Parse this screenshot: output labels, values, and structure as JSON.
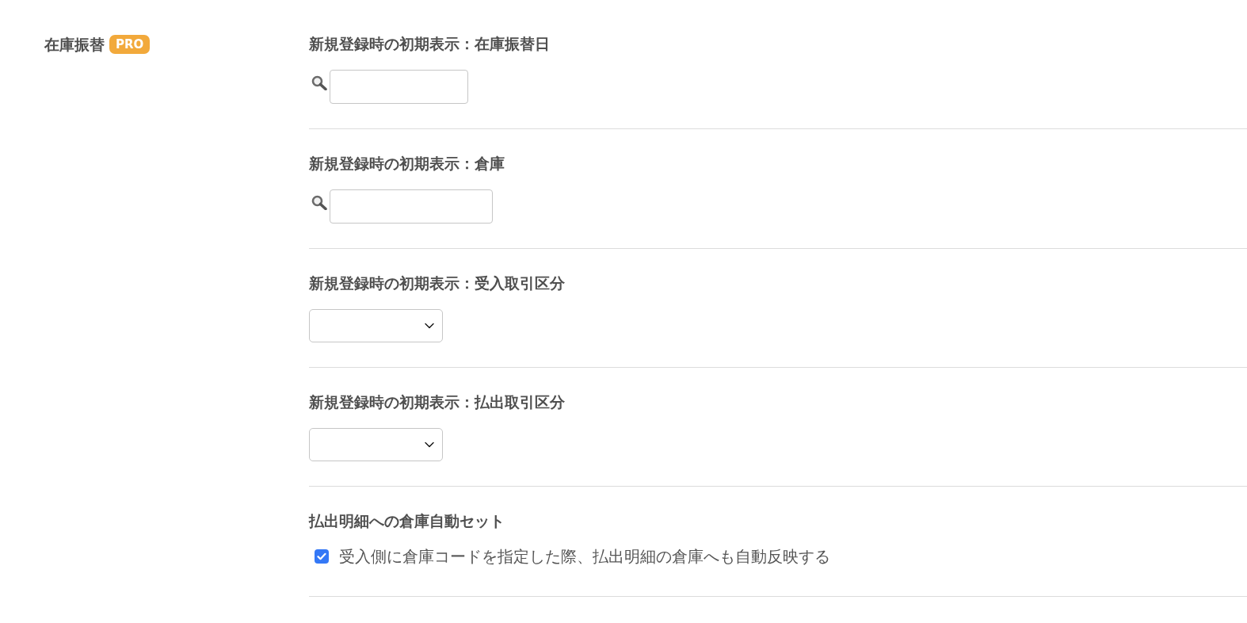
{
  "section": {
    "title": "在庫振替",
    "badge": "PRO"
  },
  "settings": [
    {
      "kind": "search",
      "label": "新規登録時の初期表示：在庫振替日"
    },
    {
      "kind": "search",
      "label": "新規登録時の初期表示：倉庫"
    },
    {
      "kind": "select",
      "label": "新規登録時の初期表示：受入取引区分"
    },
    {
      "kind": "select",
      "label": "新規登録時の初期表示：払出取引区分"
    },
    {
      "kind": "checkbox",
      "label": "払出明細への倉庫自動セット",
      "option": {
        "label": "受入側に倉庫コードを指定した際、払出明細の倉庫へも自動反映する",
        "checked": true
      }
    }
  ]
}
